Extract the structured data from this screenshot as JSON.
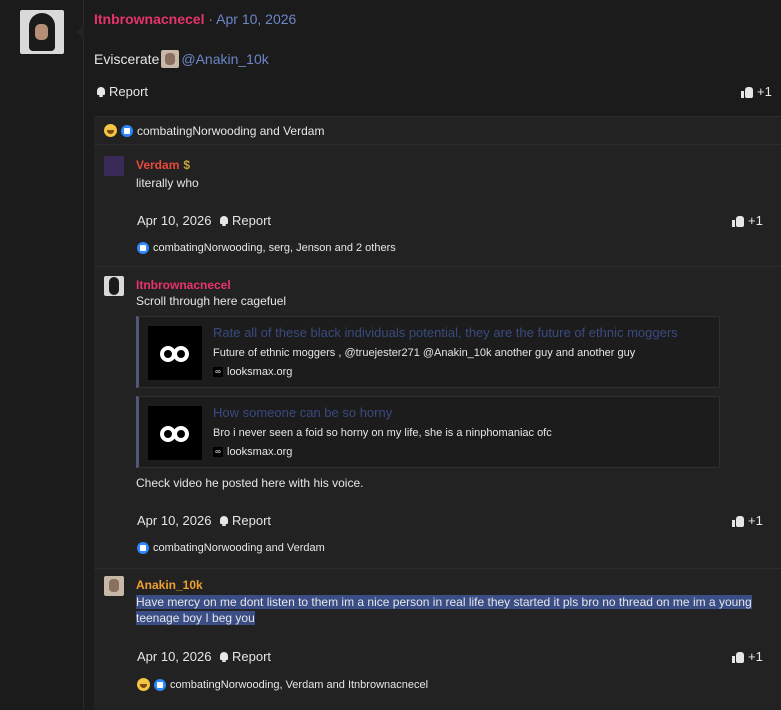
{
  "post": {
    "username": "Itnbrownacnecel",
    "separator": "·",
    "date": "Apr 10, 2026",
    "body_text": "Eviscerate",
    "mention": "@Anakin_10k",
    "report_label": "Report",
    "like_label": "+1",
    "reactions_text": "combatingNorwooding and Verdam"
  },
  "comments": [
    {
      "username": "Verdam",
      "badge": "$",
      "text": "literally who",
      "date": "Apr 10, 2026",
      "report_label": "Report",
      "like_label": "+1",
      "reactions_text": "combatingNorwooding, serg, Jenson and 2 others"
    },
    {
      "username": "Itnbrownacnecel",
      "text": "Scroll through here cagefuel",
      "embeds": [
        {
          "title": "Rate all of these black individuals potential, they are the future of ethnic moggers",
          "description": "Future of ethnic moggers , @truejester271 @Anakin_10k another guy and another guy",
          "site": "looksmax.org"
        },
        {
          "title": "How someone can be so horny",
          "description": "Bro i never seen a foid so horny on my life, she is a ninphomaniac ofc",
          "site": "looksmax.org"
        }
      ],
      "text2": "Check video he posted here with his voice.",
      "date": "Apr 10, 2026",
      "report_label": "Report",
      "like_label": "+1",
      "reactions_text": "combatingNorwooding and Verdam"
    },
    {
      "username": "Anakin_10k",
      "text_line1": "Have mercy on me dont listen to them im a nice person in real life they started it pls bro no thread on me im a young",
      "text_line2": "teenage boy I beg you",
      "date": "Apr 10, 2026",
      "report_label": "Report",
      "like_label": "+1",
      "reactions_text": "combatingNorwooding, Verdam and Itnbrownacnecel"
    }
  ],
  "colors": {
    "username_accent": "#e8336b",
    "date_link": "#6c86c8",
    "gold_name": "#f0a030",
    "selection": "#3a4d85"
  }
}
